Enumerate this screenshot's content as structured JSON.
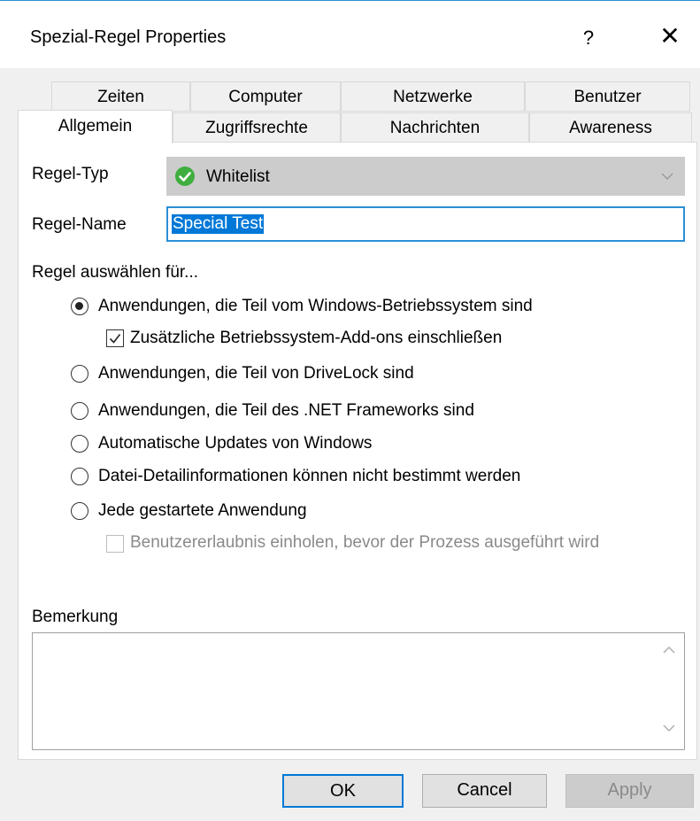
{
  "window": {
    "title": "Spezial-Regel Properties",
    "help_label": "?",
    "close_label": "✕"
  },
  "tabs": {
    "row1": [
      "Zeiten",
      "Computer",
      "Netzwerke",
      "Benutzer"
    ],
    "row2": [
      "Allgemein",
      "Zugriffsrechte",
      "Nachrichten",
      "Awareness"
    ],
    "active": "Allgemein"
  },
  "form": {
    "rule_type_label": "Regel-Typ",
    "rule_type_value": "Whitelist",
    "rule_type_icon": "green-check-circle-icon",
    "rule_name_label": "Regel-Name",
    "rule_name_value": "Special Test",
    "select_for_label": "Regel auswählen für...",
    "options": {
      "windows_os": "Anwendungen, die Teil vom Windows-Betriebssystem sind",
      "include_addons": "Zusätzliche Betriebssystem-Add-ons einschließen",
      "drivelock": "Anwendungen, die Teil von DriveLock sind",
      "dotnet": "Anwendungen, die Teil des .NET Frameworks sind",
      "windows_updates": "Automatische Updates von Windows",
      "no_file_details": "Datei-Detailinformationen können nicht bestimmt werden",
      "any_app": "Jede gestartete Anwendung",
      "ask_permission": "Benutzererlaubnis einholen, bevor der Prozess ausgeführt wird"
    },
    "selected_option": "windows_os",
    "include_addons_checked": true,
    "ask_permission_checked": false,
    "ask_permission_enabled": false,
    "remarks_label": "Bemerkung",
    "remarks_value": ""
  },
  "buttons": {
    "ok": "OK",
    "cancel": "Cancel",
    "apply": "Apply"
  },
  "colors": {
    "accent": "#0078d7",
    "check_green": "#3fae3f"
  }
}
